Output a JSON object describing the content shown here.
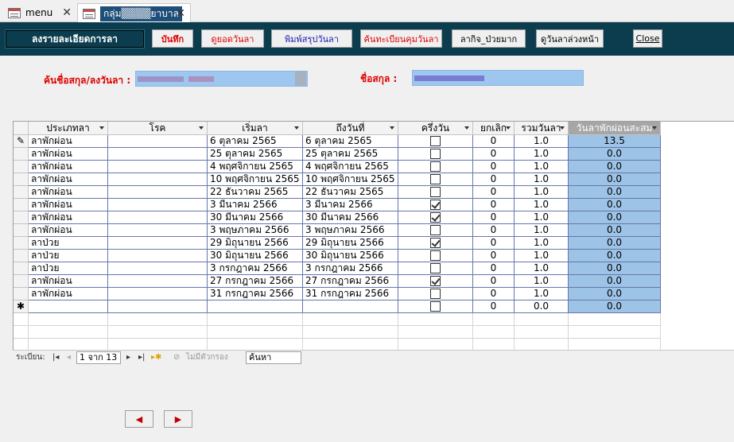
{
  "tabs": [
    {
      "label": "menu"
    },
    {
      "label": "กลุ่ม▒▒▒▒ยาบาล"
    }
  ],
  "header": {
    "title": "ลงรายละเอียดการลา",
    "buttons": {
      "save": "บันทึก",
      "view_totals": "ดูยอดวันลา",
      "print_summary": "พิมพ์สรุปวันลา",
      "search_register": "ค้นทะเบียนคุมวันลา",
      "personal_sick": "ลากิจ_ป่วยมาก",
      "advance_days": "ดูวันลาล่วงหน้า",
      "close": "Close"
    }
  },
  "search": {
    "name_label": "ค้นชื่อสกุล/ลงวันลา :",
    "surname_label": "ชื่อสกุล :"
  },
  "grid": {
    "columns": [
      "ประเภทลา",
      "โรค",
      "เริ่มลา",
      "ถึงวันที่",
      "ครึ่งวัน",
      "ยกเลิก",
      "รวมวันลา",
      "วันลาพักผ่อนสะสม"
    ],
    "rows": [
      {
        "type": "ลาพักผ่อน",
        "disease": "",
        "start": "6 ตุลาคม 2565",
        "end": "6 ตุลาคม 2565",
        "half": false,
        "cancel": "0",
        "total": "1.0",
        "accum": "13.5"
      },
      {
        "type": "ลาพักผ่อน",
        "disease": "",
        "start": "25 ตุลาคม 2565",
        "end": "25 ตุลาคม 2565",
        "half": false,
        "cancel": "0",
        "total": "1.0",
        "accum": "0.0"
      },
      {
        "type": "ลาพักผ่อน",
        "disease": "",
        "start": "4 พฤศจิกายน 2565",
        "end": "4 พฤศจิกายน 2565",
        "half": false,
        "cancel": "0",
        "total": "1.0",
        "accum": "0.0"
      },
      {
        "type": "ลาพักผ่อน",
        "disease": "",
        "start": "10 พฤศจิกายน 2565",
        "end": "10 พฤศจิกายน 2565",
        "half": false,
        "cancel": "0",
        "total": "1.0",
        "accum": "0.0"
      },
      {
        "type": "ลาพักผ่อน",
        "disease": "",
        "start": "22 ธันวาคม 2565",
        "end": "22 ธันวาคม 2565",
        "half": false,
        "cancel": "0",
        "total": "1.0",
        "accum": "0.0"
      },
      {
        "type": "ลาพักผ่อน",
        "disease": "",
        "start": "3 มีนาคม 2566",
        "end": "3 มีนาคม 2566",
        "half": true,
        "cancel": "0",
        "total": "1.0",
        "accum": "0.0"
      },
      {
        "type": "ลาพักผ่อน",
        "disease": "",
        "start": "30 มีนาคม 2566",
        "end": "30 มีนาคม 2566",
        "half": true,
        "cancel": "0",
        "total": "1.0",
        "accum": "0.0"
      },
      {
        "type": "ลาพักผ่อน",
        "disease": "",
        "start": "3 พฤษภาคม 2566",
        "end": "3 พฤษภาคม 2566",
        "half": false,
        "cancel": "0",
        "total": "1.0",
        "accum": "0.0"
      },
      {
        "type": "ลาป่วย",
        "disease": "",
        "start": "29 มิถุนายน 2566",
        "end": "29 มิถุนายน 2566",
        "half": true,
        "cancel": "0",
        "total": "1.0",
        "accum": "0.0"
      },
      {
        "type": "ลาป่วย",
        "disease": "",
        "start": "30 มิถุนายน 2566",
        "end": "30 มิถุนายน 2566",
        "half": false,
        "cancel": "0",
        "total": "1.0",
        "accum": "0.0"
      },
      {
        "type": "ลาป่วย",
        "disease": "",
        "start": "3 กรกฎาคม 2566",
        "end": "3 กรกฎาคม 2566",
        "half": false,
        "cancel": "0",
        "total": "1.0",
        "accum": "0.0"
      },
      {
        "type": "ลาพักผ่อน",
        "disease": "",
        "start": "27 กรกฎาคม 2566",
        "end": "27 กรกฎาคม 2566",
        "half": true,
        "cancel": "0",
        "total": "1.0",
        "accum": "0.0"
      },
      {
        "type": "ลาพักผ่อน",
        "disease": "",
        "start": "31 กรกฎาคม 2566",
        "end": "31 กรกฎาคม 2566",
        "half": false,
        "cancel": "0",
        "total": "1.0",
        "accum": "0.0"
      }
    ],
    "new_row": {
      "cancel": "0",
      "total": "0.0",
      "accum": "0.0"
    }
  },
  "nav": {
    "record_label": "ระเบียน:",
    "record_position": "1 จาก 13",
    "filter_label": "ไม่มีตัวกรอง",
    "search_placeholder": "ค้นหา"
  },
  "icons": {
    "edit_row": "pencil-icon",
    "new_row": "asterisk-icon",
    "prev": "triangle-left-icon",
    "next": "triangle-right-icon"
  },
  "colors": {
    "header_bg": "#0b3d4f",
    "accent_red": "#e00000",
    "accum_col": "#9dc3e6",
    "search_field": "#9ec7f0"
  }
}
